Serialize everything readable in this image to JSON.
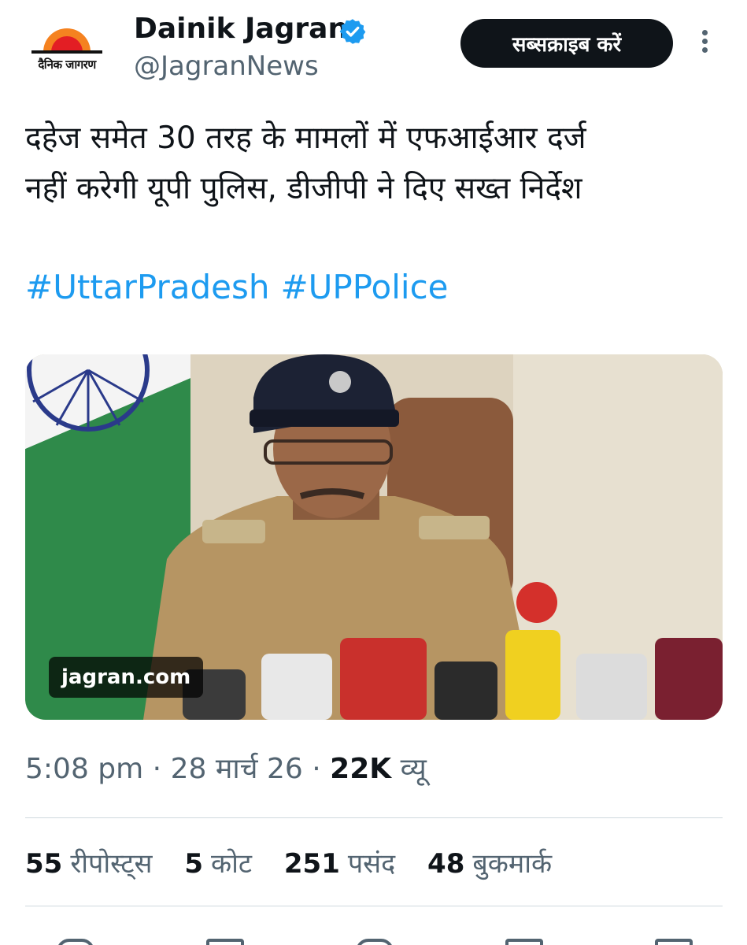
{
  "account": {
    "logo_text": "दैनिक जागरण",
    "name": "Dainik Jagran",
    "handle": "@JagranNews",
    "subscribe_label": "सब्सक्राइब करें"
  },
  "tweet": {
    "text_line1": "दहेज समेत 30 तरह के मामलों में एफआईआर दर्ज",
    "text_line2": "नहीं करेगी यूपी पुलिस, डीजीपी ने दिए सख्त निर्देश",
    "hashtags": [
      "#UttarPradesh",
      "#UPPolice"
    ],
    "media_source": "jagran.com"
  },
  "meta": {
    "time": "5:08 pm",
    "sep": "·",
    "date": "28 मार्च 26",
    "views_count": "22K",
    "views_label": "व्यू"
  },
  "stats": [
    {
      "count": "55",
      "label": "रीपोस्ट्स"
    },
    {
      "count": "5",
      "label": "कोट"
    },
    {
      "count": "251",
      "label": "पसंद"
    },
    {
      "count": "48",
      "label": "बुकमार्क"
    }
  ],
  "icons": {
    "verified": "verified-badge-icon",
    "more": "more-dots-icon"
  },
  "colors": {
    "accent": "#1d9bf0",
    "text": "#0f1419",
    "secondary": "#536471",
    "logo_orange": "#f58220",
    "logo_red": "#e31e24"
  }
}
